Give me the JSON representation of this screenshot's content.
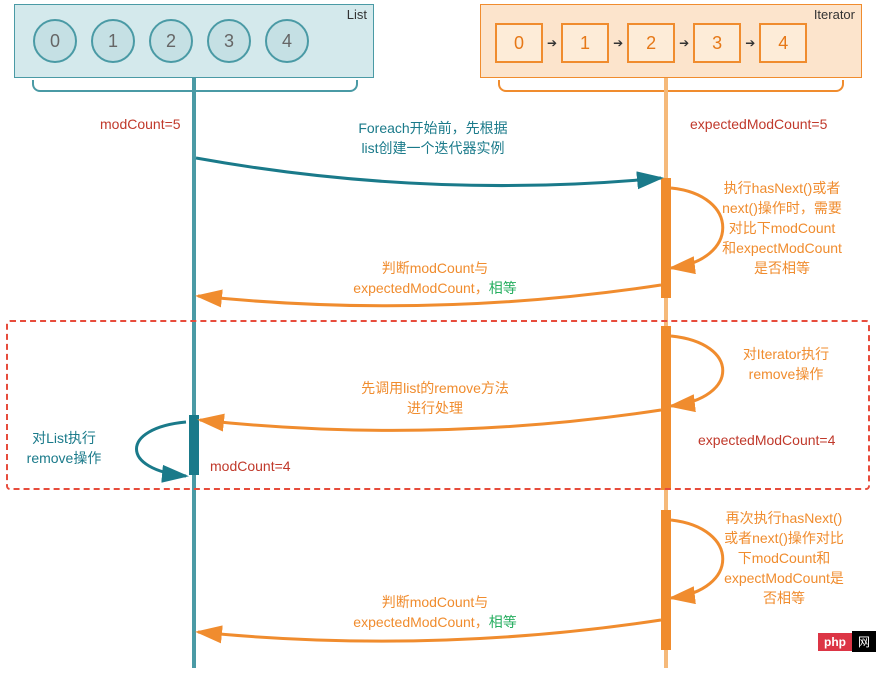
{
  "list": {
    "label": "List",
    "items": [
      "0",
      "1",
      "2",
      "3",
      "4"
    ],
    "modCountLabel": "modCount=5"
  },
  "iterator": {
    "label": "Iterator",
    "items": [
      "0",
      "1",
      "2",
      "3",
      "4"
    ],
    "expectedLabel": "expectedModCount=5"
  },
  "messages": {
    "foreach_line1": "Foreach开始前，先根据",
    "foreach_line2": "list创建一个迭代器实例",
    "hasnext1_line1": "执行hasNext()或者",
    "hasnext1_line2": "next()操作时，需要",
    "hasnext1_line3": "对比下modCount",
    "hasnext1_line4": "和expectModCount",
    "hasnext1_line5": "是否相等",
    "judge1_line1": "判断modCount与",
    "judge1_line2_a": "expectedModCount，",
    "judge1_line2_b": "相等",
    "iter_remove_line1": "对Iterator执行",
    "iter_remove_line2": "remove操作",
    "list_remove_line1": "先调用list的remove方法",
    "list_remove_line2": "进行处理",
    "list_remove_label_line1": "对List执行",
    "list_remove_label_line2": "remove操作",
    "modcount4": "modCount=4",
    "expected4": "expectedModCount=4",
    "hasnext2_line1": "再次执行hasNext()",
    "hasnext2_line2": "或者next()操作对比",
    "hasnext2_line3": "下modCount和",
    "hasnext2_line4": "expectModCount是",
    "hasnext2_line5": "否相等",
    "judge2_line1": "判断modCount与",
    "judge2_line2_a": "expectedModCount，",
    "judge2_line2_b": "相等"
  },
  "badge": {
    "left": "php",
    "right": "网"
  },
  "colors": {
    "teal": "#4a9aa5",
    "orange": "#f08c2e",
    "red": "#c0392b",
    "green": "#27ae60"
  }
}
